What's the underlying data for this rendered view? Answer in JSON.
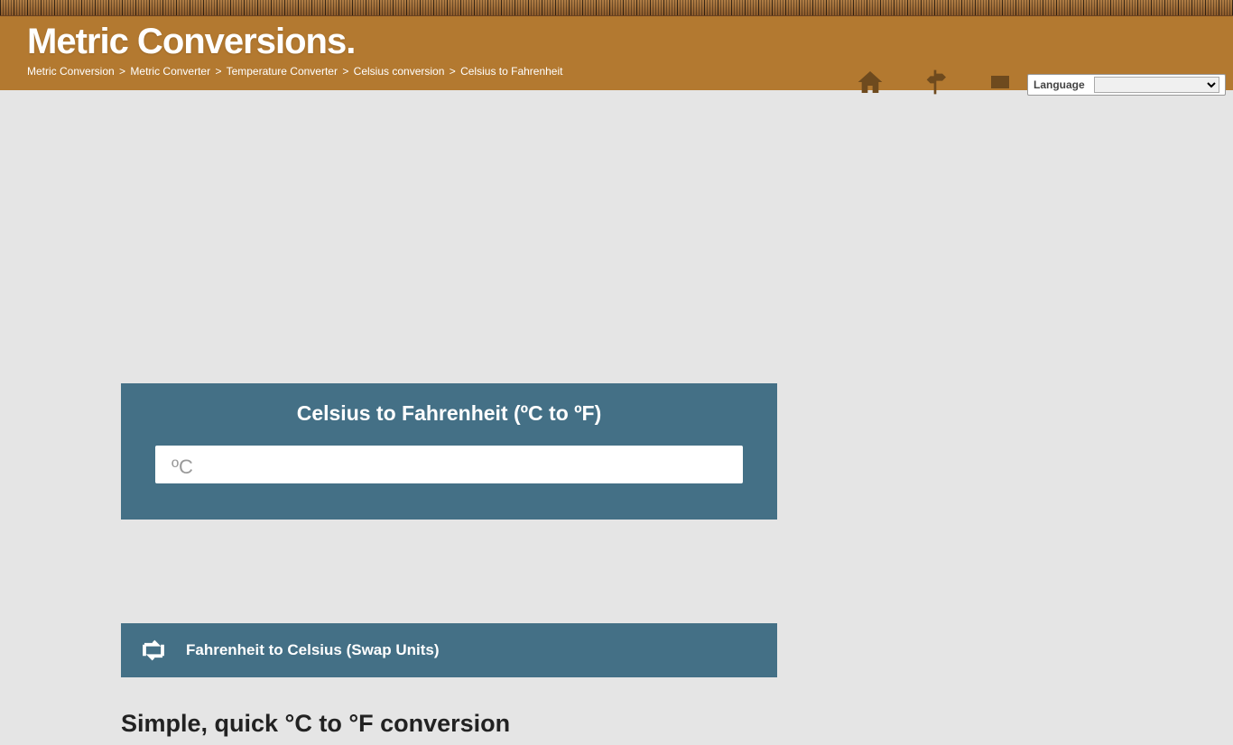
{
  "header": {
    "logo_text": "Metric Conversions.",
    "breadcrumb": [
      "Metric Conversion",
      "Metric Converter",
      "Temperature Converter",
      "Celsius conversion",
      "Celsius to Fahrenheit"
    ],
    "language_label": "Language"
  },
  "converter": {
    "title": "Celsius to Fahrenheit (ºC to ºF)",
    "unit_prefix": "ºC",
    "input_value": ""
  },
  "swap": {
    "label": "Fahrenheit to Celsius (Swap Units)"
  },
  "section": {
    "heading": "Simple, quick °C to °F conversion"
  }
}
